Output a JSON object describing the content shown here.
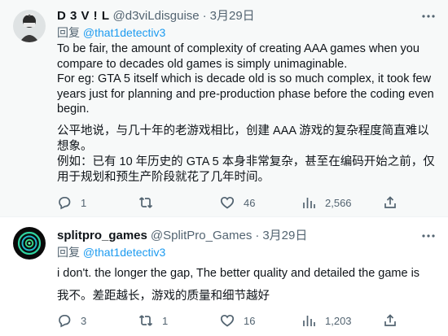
{
  "tweets": [
    {
      "display_name": "D 3 V ! L",
      "handle": "@d3viLdisguise",
      "dot": "·",
      "date": "3月29日",
      "reply_prefix": "回复 ",
      "reply_to": "@that1detectiv3",
      "body_en": [
        "To be fair, the amount of complexity of creating AAA games when you compare to decades old games is simply unimaginable.",
        "For eg: GTA 5 itself which is decade old is so much complex, it took few years just for planning and pre-production phase before the coding even begin."
      ],
      "body_zh": [
        "公平地说，与几十年的老游戏相比，创建 AAA 游戏的复杂程度简直难以想象。",
        "例如：已有 10 年历史的 GTA 5 本身非常复杂，甚至在编码开始之前，仅用于规划和预生产阶段就花了几年时间。"
      ],
      "replies": "1",
      "retweets": "",
      "likes": "46",
      "views": "2,566"
    },
    {
      "display_name": "splitpro_games",
      "handle": "@SplitPro_Games",
      "dot": "·",
      "date": "3月29日",
      "reply_prefix": "回复 ",
      "reply_to": "@that1detectiv3",
      "body_en": [
        "i don't. the longer the gap, The better quality and detailed the game is"
      ],
      "body_zh": [
        "我不。差距越长，游戏的质量和细节越好"
      ],
      "replies": "3",
      "retweets": "1",
      "likes": "16",
      "views": "1,203"
    }
  ],
  "icons": {
    "more": "more-horizontal-icon",
    "reply": "reply-icon",
    "retweet": "retweet-icon",
    "like": "heart-icon",
    "views": "views-icon",
    "share": "share-icon"
  },
  "colors": {
    "text_primary": "#0f1419",
    "text_secondary": "#536471",
    "link": "#1d9bf0",
    "hover_bg": "#f7f9f9"
  }
}
